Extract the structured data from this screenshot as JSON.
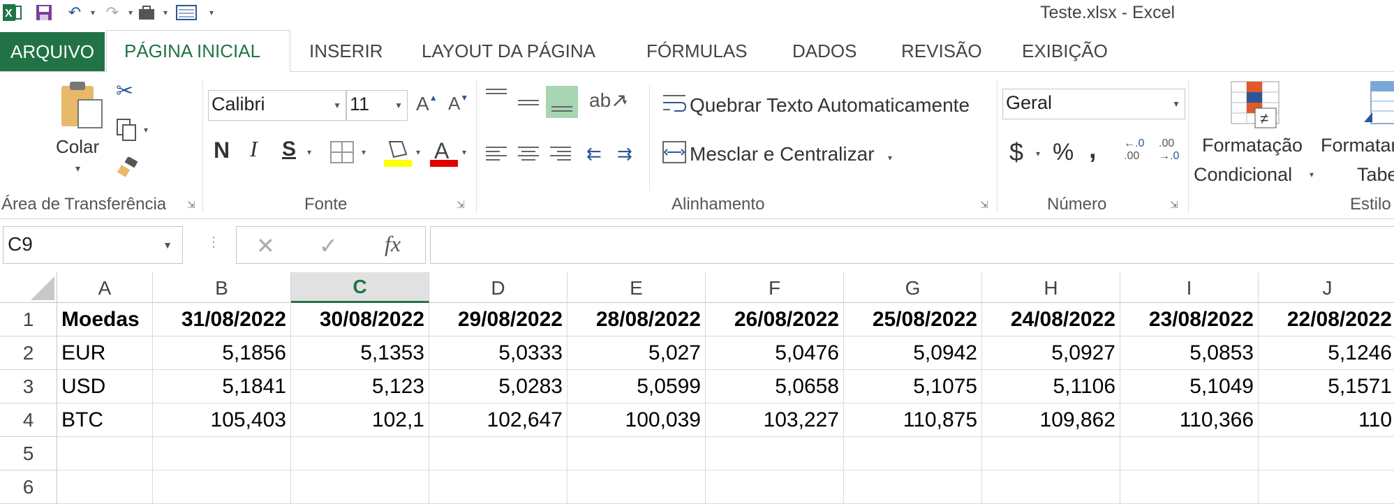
{
  "window": {
    "title": "Teste.xlsx - Excel"
  },
  "tabs": [
    {
      "label": "ARQUIVO"
    },
    {
      "label": "PÁGINA INICIAL"
    },
    {
      "label": "INSERIR"
    },
    {
      "label": "LAYOUT DA PÁGINA"
    },
    {
      "label": "FÓRMULAS"
    },
    {
      "label": "DADOS"
    },
    {
      "label": "REVISÃO"
    },
    {
      "label": "EXIBIÇÃO"
    }
  ],
  "ribbon": {
    "clipboard": {
      "paste_label": "Colar",
      "group_label": "Área de Transferência"
    },
    "font": {
      "font_name": "Calibri",
      "font_size": "11",
      "bold": "N",
      "italic": "I",
      "underline": "S",
      "group_label": "Fonte"
    },
    "alignment": {
      "wrap_label": "Quebrar Texto Automaticamente",
      "merge_label": "Mesclar e Centralizar",
      "group_label": "Alinhamento"
    },
    "number": {
      "format": "Geral",
      "currency": "$",
      "percent": "%",
      "comma": ",",
      "group_label": "Número"
    },
    "styles": {
      "cond_format_line1": "Formatação",
      "cond_format_line2": "Condicional",
      "table_format_line1": "Formatar",
      "table_format_line2": "Tabe",
      "group_label": "Estilo"
    }
  },
  "formula_bar": {
    "name_box": "C9",
    "fx": "fx",
    "formula": ""
  },
  "sheet": {
    "columns": [
      "A",
      "B",
      "C",
      "D",
      "E",
      "F",
      "G",
      "H",
      "I",
      "J"
    ],
    "selected_column": "C",
    "row_numbers": [
      "1",
      "2",
      "3",
      "4",
      "5",
      "6"
    ],
    "rows": [
      [
        "Moedas",
        "31/08/2022",
        "30/08/2022",
        "29/08/2022",
        "28/08/2022",
        "26/08/2022",
        "25/08/2022",
        "24/08/2022",
        "23/08/2022",
        "22/08/2022"
      ],
      [
        "EUR",
        "5,1856",
        "5,1353",
        "5,0333",
        "5,027",
        "5,0476",
        "5,0942",
        "5,0927",
        "5,0853",
        "5,1246"
      ],
      [
        "USD",
        "5,1841",
        "5,123",
        "5,0283",
        "5,0599",
        "5,0658",
        "5,1075",
        "5,1106",
        "5,1049",
        "5,1571"
      ],
      [
        "BTC",
        "105,403",
        "102,1",
        "102,647",
        "100,039",
        "103,227",
        "110,875",
        "109,862",
        "110,366",
        "110"
      ],
      [
        "",
        "",
        "",
        "",
        "",
        "",
        "",
        "",
        "",
        ""
      ],
      [
        "",
        "",
        "",
        "",
        "",
        "",
        "",
        "",
        "",
        ""
      ]
    ]
  },
  "colors": {
    "excel_green": "#217346",
    "highlight_yellow": "#ffff00",
    "font_red": "#e00000"
  }
}
